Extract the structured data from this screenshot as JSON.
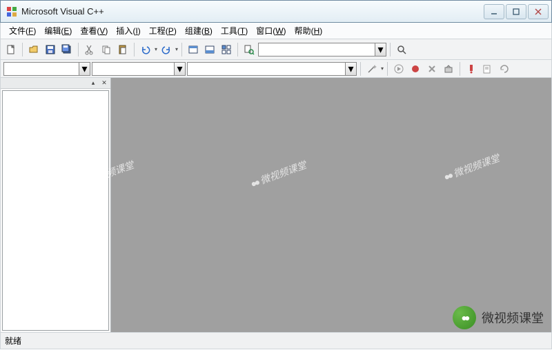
{
  "app": {
    "title": "Microsoft Visual C++"
  },
  "menu": {
    "file": {
      "label": "文件",
      "hotkey": "F"
    },
    "edit": {
      "label": "编辑",
      "hotkey": "E"
    },
    "view": {
      "label": "查看",
      "hotkey": "V"
    },
    "insert": {
      "label": "插入",
      "hotkey": "I"
    },
    "project": {
      "label": "工程",
      "hotkey": "P"
    },
    "build": {
      "label": "组建",
      "hotkey": "B"
    },
    "tools": {
      "label": "工具",
      "hotkey": "T"
    },
    "window": {
      "label": "窗口",
      "hotkey": "W"
    },
    "help": {
      "label": "帮助",
      "hotkey": "H"
    }
  },
  "combos": {
    "class_combo": "",
    "member_combo": "",
    "function_combo": "",
    "find_combo": ""
  },
  "status": {
    "text": "就绪"
  },
  "watermark": {
    "text": "微视频课堂"
  },
  "brand": {
    "text": "微视频课堂"
  }
}
